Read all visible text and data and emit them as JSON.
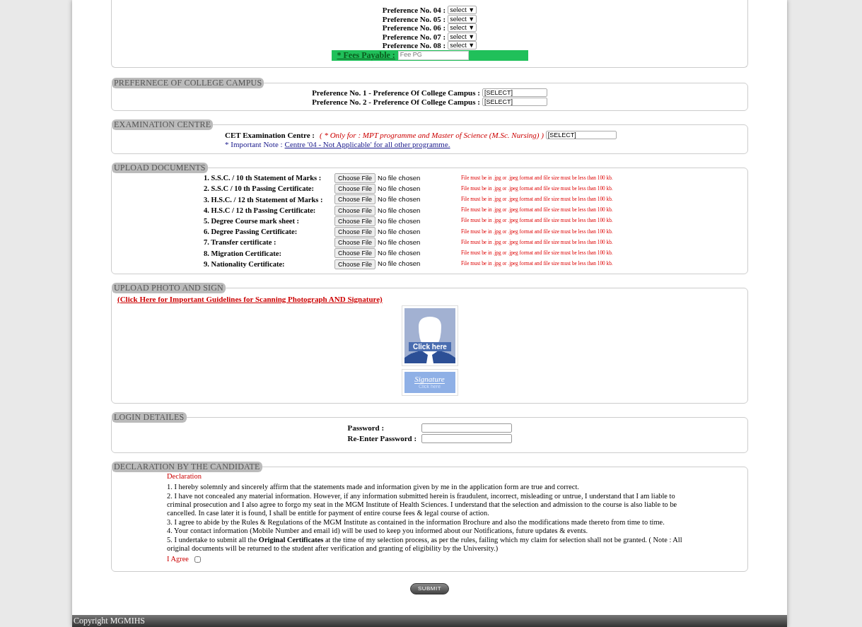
{
  "preferences": [
    {
      "label": "Preference No. 04 :",
      "value": "select ▼"
    },
    {
      "label": "Preference No. 05 :",
      "value": "select ▼"
    },
    {
      "label": "Preference No. 06 :",
      "value": "select ▼"
    },
    {
      "label": "Preference No. 07 :",
      "value": "select ▼"
    },
    {
      "label": "Preference No. 08 :",
      "value": "select ▼"
    }
  ],
  "fees": {
    "label": "* Fees Payable :",
    "placeholder": "Fee PG"
  },
  "campus": {
    "legend": "PREFERNECE OF COLLEGE CAMPUS",
    "rows": [
      {
        "label": "Preference No. 1 - Preference Of College Campus :",
        "value": "[SELECT]"
      },
      {
        "label": "Preference No. 2 - Preference Of College Campus :",
        "value": "[SELECT]"
      }
    ]
  },
  "exam": {
    "legend": "EXAMINATION CENTRE",
    "label": "CET Examination Centre :",
    "hint": "( * Only for : MPT programme and Master of Science (M.Sc. Nursing) )",
    "value": "[SELECT]",
    "note_prefix": "* Important Note :",
    "note_link": "Centre '04 - Not Applicable' for all other programme."
  },
  "uploads": {
    "legend": "UPLOAD DOCUMENTS",
    "rows": [
      {
        "label": "1. S.S.C. / 10 th Statement of Marks :",
        "button": "Choose File",
        "status": "No file chosen",
        "hint": "File must be in .jpg or .jpeg format and file size must be less than 100 kb."
      },
      {
        "label": "2. S.S.C / 10 th Passing Certificate:",
        "button": "Choose File",
        "status": "No file chosen",
        "hint": "File must be in .jpg or .jpeg format and file size must be less than 100 kb."
      },
      {
        "label": "3. H.S.C. / 12 th Statement of Marks :",
        "button": "Choose File",
        "status": "No file chosen",
        "hint": "File must be in .jpg or .jpeg format and file size must be less than 100 kb."
      },
      {
        "label": "4. H.S.C / 12 th Passing Certificate:",
        "button": "Choose File",
        "status": "No file chosen",
        "hint": "File must be in .jpg or .jpeg format and file size must be less than 100 kb."
      },
      {
        "label": "5. Degree Course mark sheet :",
        "button": "Choose File",
        "status": "No file chosen",
        "hint": "File must be in .jpg or .jpeg format and file size must be less than 100 kb."
      },
      {
        "label": "6. Degree Passing Certificate:",
        "button": "Choose File",
        "status": "No file chosen",
        "hint": "File must be in .jpg or .jpeg format and file size must be less than 100 kb."
      },
      {
        "label": "7. Transfer certificate :",
        "button": "Choose File",
        "status": "No file chosen",
        "hint": "File must be in .jpg or .jpeg format and file size must be less than 100 kb."
      },
      {
        "label": "8. Migration Certificate:",
        "button": "Choose File",
        "status": "No file chosen",
        "hint": "File must be in .jpg or .jpeg format and file size must be less than 100 kb."
      },
      {
        "label": "9. Nationality Certificate:",
        "button": "Choose File",
        "status": "No file chosen",
        "hint": "File must be in .jpg or .jpeg format and file size must be less than 100 kb."
      }
    ]
  },
  "photo": {
    "legend": "UPLOAD PHOTO AND SIGN",
    "link": "(Click Here for Important Guidelines for Scanning Photograph AND Signature)",
    "photo_text": "Click here",
    "sign_text": "Signature",
    "sign_subtext": "Click here"
  },
  "login": {
    "legend": "LOGIN DETAILES",
    "fields": [
      {
        "label": "Password :"
      },
      {
        "label": "Re-Enter Password :"
      }
    ]
  },
  "declaration": {
    "legend": "DECLARATION BY THE CANDIDATE",
    "heading": "Declaration",
    "paragraphs": [
      "1. I hereby solemnly and sincerely affirm that the statements made and information given by me in the application form are true and correct.",
      "2. I have not concealed any material information. However, if any information submitted herein is fraudulent, incorrect, misleading or untrue, I understand that I am liable to criminal prosecution and I also agree to forgo my seat in the MGM Institute of Health Sciences. I understand that the selection and admission to the course is also liable to be cancelled. In case later it is found, I shall be entitle for payment of entire course fees & legal course of action.",
      "3. I agree to abide by the Rules & Regulations of the MGM Institute as contained in the information Brochure and also the modifications made thereto from time to time.",
      "4. Your contact information (Mobile Number and email id) will be used to keep you informed about our Notifications, future updates & events.",
      "5. I undertake to submit all the **Original Certificates** at the time of my selection process, as per the rules, failing which my claim for selection shall not be granted. ( Note : All original documents will be returned to the student after verification and granting of eligibility by the University.)"
    ],
    "agree_label": "I Agree",
    "agree_checked": false
  },
  "submit": "SUBMIT",
  "footer": "Copyright MGMIHS"
}
